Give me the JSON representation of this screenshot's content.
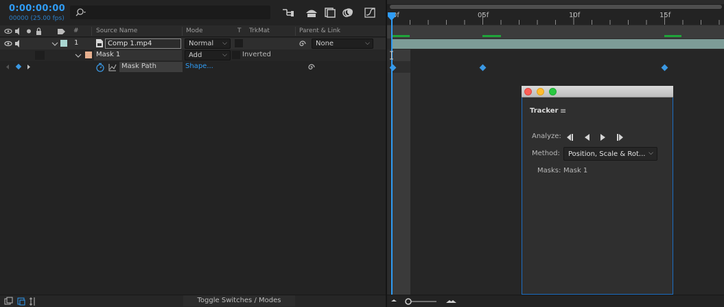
{
  "header": {
    "timecode": "0:00:00:00",
    "frame_info": "00000 (25.00 fps)",
    "search_placeholder": ""
  },
  "columns": {
    "source_name": "Source Name",
    "mode": "Mode",
    "t": "T",
    "trkmat": "TrkMat",
    "parent": "Parent & Link",
    "number": "#"
  },
  "layer": {
    "number": "1",
    "name": "Comp 1.mp4",
    "mode": "Normal",
    "parent": "None",
    "label_color": "#a9d6d1"
  },
  "mask": {
    "name": "Mask 1",
    "mode": "Add",
    "inverted_label": "Inverted",
    "label_color": "#e7b08f"
  },
  "mask_path": {
    "name": "Mask Path",
    "value": "Shape..."
  },
  "footer": {
    "toggle_label": "Toggle Switches / Modes"
  },
  "ruler": {
    "labels": [
      "0f",
      "05f",
      "10f",
      "15f"
    ]
  },
  "tracker": {
    "title": "Tracker",
    "analyze_label": "Analyze:",
    "method_label": "Method:",
    "method_value": "Position, Scale & Rot...",
    "masks_label": "Masks:",
    "masks_value": "Mask 1"
  },
  "colors": {
    "accent": "#2f9cf5",
    "keyframe": "#3a98e3",
    "work_area_marker": "#1fa53a",
    "layer_bar": "#7d9c97"
  }
}
